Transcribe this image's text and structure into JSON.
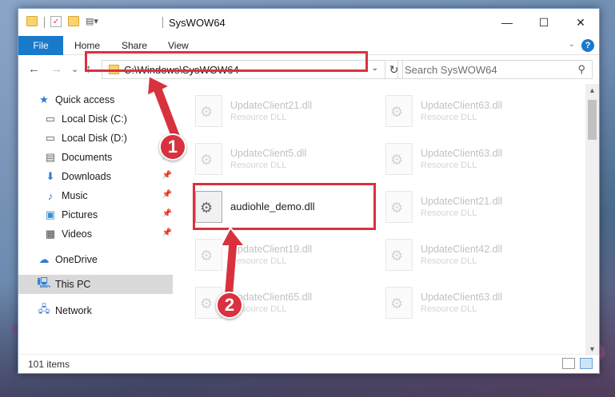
{
  "window": {
    "title": "SysWOW64"
  },
  "ribbon": {
    "tabs": [
      "File",
      "Home",
      "Share",
      "View"
    ],
    "help": "?"
  },
  "nav": {
    "back": "←",
    "forward": "→",
    "recent": "⌄",
    "up": "↑"
  },
  "address": {
    "path": "C:\\Windows\\SysWOW64",
    "refresh": "↻"
  },
  "search": {
    "placeholder": "Search SysWOW64"
  },
  "sidebar": {
    "items": [
      {
        "label": "Quick access",
        "icon": "star-icon",
        "pinned": false
      },
      {
        "label": "Local Disk (C:)",
        "icon": "drive-icon",
        "pinned": true
      },
      {
        "label": "Local Disk (D:)",
        "icon": "drive-icon",
        "pinned": false
      },
      {
        "label": "Documents",
        "icon": "documents-icon",
        "pinned": true
      },
      {
        "label": "Downloads",
        "icon": "download-icon",
        "pinned": true
      },
      {
        "label": "Music",
        "icon": "music-icon",
        "pinned": true
      },
      {
        "label": "Pictures",
        "icon": "pictures-icon",
        "pinned": true
      },
      {
        "label": "Videos",
        "icon": "videos-icon",
        "pinned": true
      },
      {
        "label": "OneDrive",
        "icon": "cloud-icon",
        "pinned": false
      },
      {
        "label": "This PC",
        "icon": "computer-icon",
        "pinned": false,
        "selected": true
      },
      {
        "label": "Network",
        "icon": "network-icon",
        "pinned": false
      }
    ]
  },
  "files": [
    {
      "name": "UpdateClient21.dll",
      "type": "Resource DLL"
    },
    {
      "name": "UpdateClient63.dll",
      "type": "Resource DLL"
    },
    {
      "name": "UpdateClient5.dll",
      "type": "Resource DLL"
    },
    {
      "name": "UpdateClient63.dll",
      "type": "Resource DLL"
    },
    {
      "name": "audiohle_demo.dll",
      "type": ""
    },
    {
      "name": "UpdateClient21.dll",
      "type": "Resource DLL"
    },
    {
      "name": "UpdateClient19.dll",
      "type": "Resource DLL"
    },
    {
      "name": "UpdateClient42.dll",
      "type": "Resource DLL"
    },
    {
      "name": "UpdateClient65.dll",
      "type": "Resource DLL"
    },
    {
      "name": "UpdateClient63.dll",
      "type": "Resource DLL"
    }
  ],
  "status": {
    "item_count": "101 items"
  },
  "annotations": {
    "step1": "1",
    "step2": "2",
    "color": "#d8323f"
  }
}
